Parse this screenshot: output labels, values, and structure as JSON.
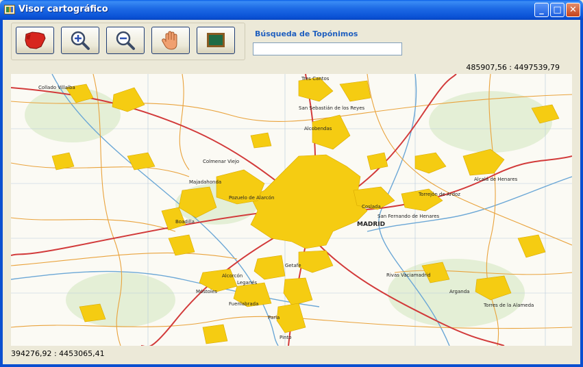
{
  "window": {
    "title": "Visor cartográfico",
    "minimize_glyph": "_",
    "maximize_glyph": "□",
    "close_glyph": "✕"
  },
  "toolbar": {
    "buttons": [
      {
        "name": "spain-map-button",
        "icon": "spain-map-icon"
      },
      {
        "name": "zoom-in-button",
        "icon": "zoom-in-icon"
      },
      {
        "name": "zoom-out-button",
        "icon": "zoom-out-icon"
      },
      {
        "name": "pan-hand-button",
        "icon": "hand-icon"
      },
      {
        "name": "board-button",
        "icon": "board-icon"
      }
    ]
  },
  "search": {
    "label": "Búsqueda de Topónimos",
    "value": "",
    "placeholder": ""
  },
  "coordinates": {
    "top_right": "485907,56 : 4497539,79",
    "bottom_left": "394276,92 : 4453065,41"
  },
  "map": {
    "labels": {
      "madrid": "MADRID",
      "alcobendas": "Alcobendas",
      "san_sebastian": "San Sebastián de los Reyes",
      "tres_cantos": "Tres Cantos",
      "pozuelo": "Pozuelo de Alarcón",
      "majadahonda": "Majadahonda",
      "torrejon": "Torrejón de Ardoz",
      "alcala": "Alcalá de Henares",
      "coslada": "Coslada",
      "san_fernando": "San Fernando de Henares",
      "rivas": "Rivas Vaciamadrid",
      "getafe": "Getafe",
      "leganes": "Leganés",
      "alcorcon": "Alcorcón",
      "mostoles": "Móstoles",
      "fuenlabrada": "Fuenlabrada",
      "parla": "Parla",
      "pinto": "Pinto",
      "arganda": "Arganda",
      "boadilla": "Boadilla",
      "colmenar": "Colmenar Viejo",
      "torres": "Torres de la Alameda",
      "collado": "Collado Villalba"
    },
    "colors": {
      "urban": "#F5CC12",
      "background": "#FBFAF4",
      "road_major": "#D23A3A",
      "road_minor": "#E9A23B",
      "river": "#6BA7D6",
      "green": "#7CB36A"
    }
  }
}
